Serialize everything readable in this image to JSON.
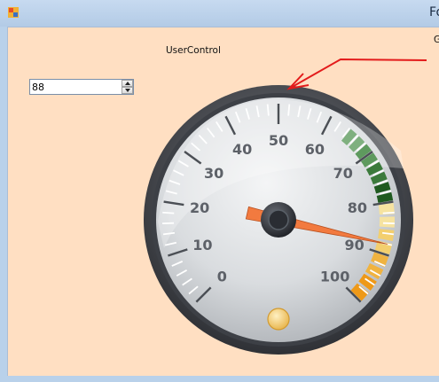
{
  "window": {
    "title": "Fo",
    "colors": {
      "client_background": "#ffdfc2",
      "frame": "#b9d1ea",
      "annotation_arrow": "#e31b1b"
    }
  },
  "labels": {
    "usercontrol": "UserControl",
    "clipped_right": "G"
  },
  "numeric_updown": {
    "value": "88"
  },
  "gauge": {
    "min": 0,
    "max": 100,
    "value": 88,
    "tick_labels": [
      "0",
      "10",
      "20",
      "30",
      "40",
      "50",
      "60",
      "70",
      "80",
      "90",
      "100"
    ],
    "bands": [
      {
        "from": 64,
        "to": 80,
        "colors": [
          "#7fb07f",
          "#5e9a5e",
          "#3b7a3b",
          "#1f5a1f"
        ]
      },
      {
        "from": 80,
        "to": 100,
        "colors": [
          "#f6e3a0",
          "#f3cf6e",
          "#f0b340",
          "#ee9918"
        ]
      }
    ],
    "colors": {
      "needle": "#f27a3f",
      "hub": "#2a2d33",
      "bezel": "#4a4d53",
      "face": "#d6d9dd"
    }
  }
}
